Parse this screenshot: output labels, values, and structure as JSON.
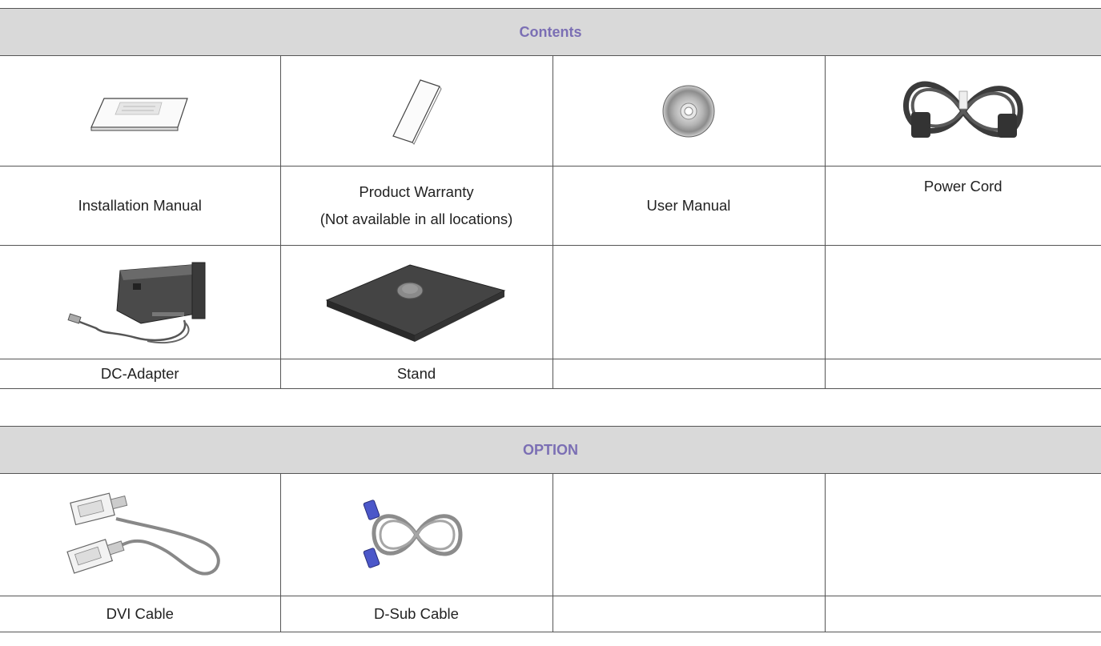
{
  "contents": {
    "header": "Contents",
    "items": [
      {
        "label": "Installation Manual",
        "icon": "installation-manual-icon"
      },
      {
        "label": "Product Warranty",
        "sublabel": "(Not available in all locations)",
        "icon": "warranty-booklet-icon"
      },
      {
        "label": "User Manual",
        "icon": "cd-disc-icon"
      },
      {
        "label": "Power Cord",
        "icon": "power-cord-icon"
      },
      {
        "label": "DC-Adapter",
        "icon": "dc-adapter-icon"
      },
      {
        "label": "Stand",
        "icon": "stand-icon"
      }
    ]
  },
  "option": {
    "header": "OPTION",
    "items": [
      {
        "label": "DVI Cable",
        "icon": "dvi-cable-icon"
      },
      {
        "label": "D-Sub Cable",
        "icon": "d-sub-cable-icon"
      }
    ]
  }
}
